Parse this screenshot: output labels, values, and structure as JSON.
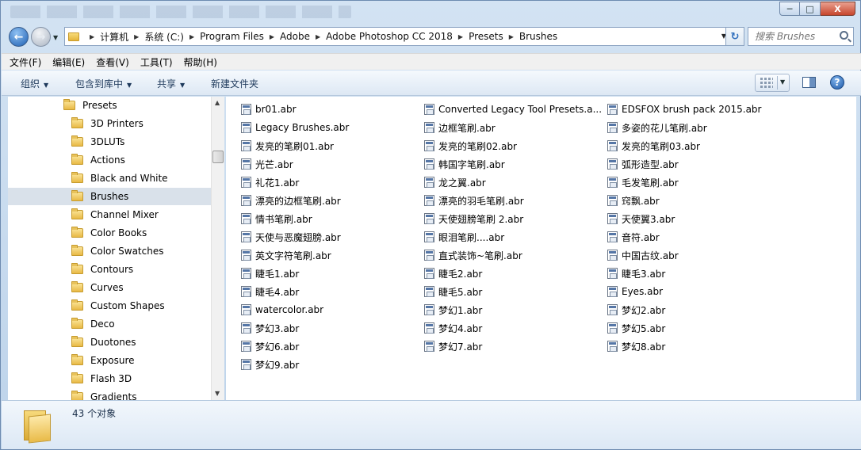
{
  "window": {
    "caption_buttons": {
      "minimize": "─",
      "maximize": "□",
      "close": "X"
    }
  },
  "address_bar": {
    "breadcrumbs": [
      "计算机",
      "系统 (C:)",
      "Program Files",
      "Adobe",
      "Adobe Photoshop CC 2018",
      "Presets",
      "Brushes"
    ],
    "search_placeholder": "搜索 Brushes"
  },
  "menu": [
    "文件(F)",
    "编辑(E)",
    "查看(V)",
    "工具(T)",
    "帮助(H)"
  ],
  "toolbar": {
    "organize": "组织",
    "include_in_library": "包含到库中",
    "share": "共享",
    "new_folder": "新建文件夹"
  },
  "nav_tree": {
    "parent": "Presets",
    "selected": "Brushes",
    "children": [
      "3D Printers",
      "3DLUTs",
      "Actions",
      "Black and White",
      "Brushes",
      "Channel Mixer",
      "Color Books",
      "Color Swatches",
      "Contours",
      "Curves",
      "Custom Shapes",
      "Deco",
      "Duotones",
      "Exposure",
      "Flash 3D",
      "Gradients"
    ]
  },
  "files": {
    "columns": [
      [
        "br01.abr",
        "Legacy Brushes.abr",
        "发亮的笔刷01.abr",
        "光芒.abr",
        "礼花1.abr",
        "漂亮的边框笔刷.abr",
        "情书笔刷.abr",
        "天使与恶魔翅膀.abr",
        "英文字符笔刷.abr",
        "睫毛1.abr",
        "睫毛4.abr",
        "watercolor.abr",
        "梦幻3.abr",
        "梦幻6.abr",
        "梦幻9.abr"
      ],
      [
        "Converted Legacy Tool Presets.a...",
        "边框笔刷.abr",
        "发亮的笔刷02.abr",
        "韩国字笔刷.abr",
        "龙之翼.abr",
        "漂亮的羽毛笔刷.abr",
        "天使翅膀笔刷 2.abr",
        "眼泪笔刷....abr",
        "直式装饰~笔刷.abr",
        "睫毛2.abr",
        "睫毛5.abr",
        "梦幻1.abr",
        "梦幻4.abr",
        "梦幻7.abr"
      ],
      [
        "EDSFOX brush pack 2015.abr",
        "多姿的花儿笔刷.abr",
        "发亮的笔刷03.abr",
        "弧形造型.abr",
        "毛发笔刷.abr",
        "窍飘.abr",
        "天使翼3.abr",
        "音符.abr",
        "中国古纹.abr",
        "睫毛3.abr",
        "Eyes.abr",
        "梦幻2.abr",
        "梦幻5.abr",
        "梦幻8.abr"
      ]
    ]
  },
  "status": {
    "count_text": "43 个对象"
  },
  "colors": {
    "window_frame": "#bdd3ea",
    "selection": "#d9e1ea",
    "accent": "#1e5fb2"
  }
}
